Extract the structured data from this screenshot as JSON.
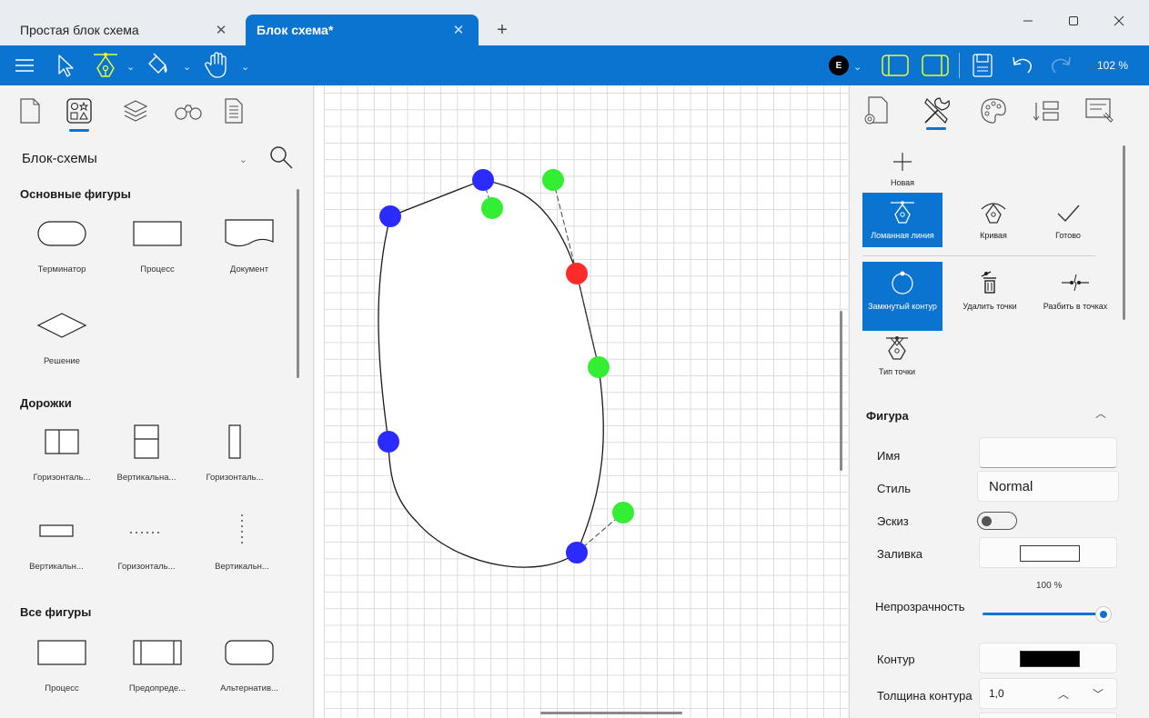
{
  "window": {
    "tabs": [
      {
        "title": "Простая блок схема",
        "active": false
      },
      {
        "title": "Блок схема*",
        "active": true
      }
    ],
    "add_tab": "+",
    "controls": {
      "minimize": "minimize",
      "maximize": "maximize",
      "close": "close"
    }
  },
  "toolbar": {
    "avatar_letter": "E",
    "zoom": "102 %",
    "accent": "#0b74d1",
    "highlight": "#e5ff2e"
  },
  "left_panel": {
    "category": "Блок-схемы",
    "sections": [
      {
        "title": "Основные фигуры",
        "items": [
          "Терминатор",
          "Процесс",
          "Документ",
          "Решение"
        ]
      },
      {
        "title": "Дорожки",
        "items": [
          "Горизонталь...",
          "Вертикальна...",
          "Горизонталь...",
          "Вертикальн...",
          "Горизонталь...",
          "Вертикальн..."
        ]
      },
      {
        "title": "Все фигуры",
        "items": [
          "Процесс",
          "Предопреде...",
          "Альтернатив..."
        ]
      }
    ]
  },
  "canvas": {
    "point_colors": {
      "anchor": "#2b2bff",
      "control": "#33ee33",
      "selected": "#ff2a2a"
    }
  },
  "right_panel": {
    "tools": [
      {
        "label": "Новая",
        "active": false
      },
      {
        "label": "Ломанная линия",
        "active": true
      },
      {
        "label": "Кривая",
        "active": false
      },
      {
        "label": "Готово",
        "active": false
      },
      {
        "label": "Замкнутый контур",
        "active": true
      },
      {
        "label": "Удалить точки",
        "active": false
      },
      {
        "label": "Разбить в точках",
        "active": false
      },
      {
        "label": "Тип точки",
        "active": false
      }
    ],
    "figure": {
      "title": "Фигура",
      "name_label": "Имя",
      "name_value": "",
      "style_label": "Стиль",
      "style_value": "Normal",
      "sketch_label": "Эскиз",
      "sketch_on": false,
      "fill_label": "Заливка",
      "fill_color": "#ffffff",
      "opacity_value": "100 %",
      "opacity_label": "Непрозрачность",
      "outline_label": "Контур",
      "outline_color": "#000000",
      "thickness_label": "Толщина контура",
      "thickness_value": "1,0"
    }
  }
}
